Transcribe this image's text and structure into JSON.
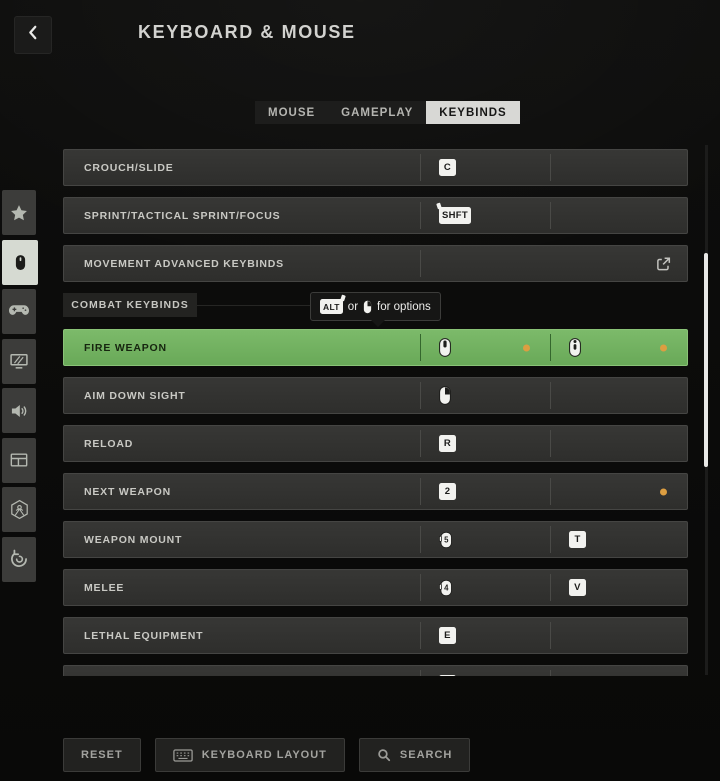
{
  "header": {
    "title": "KEYBOARD & MOUSE"
  },
  "tabs": {
    "items": [
      {
        "label": "MOUSE",
        "selected": false
      },
      {
        "label": "GAMEPLAY",
        "selected": false
      },
      {
        "label": "KEYBINDS",
        "selected": true
      }
    ]
  },
  "sidebar": {
    "items": [
      {
        "icon": "star-icon",
        "selected": false
      },
      {
        "icon": "mouse-icon",
        "selected": true
      },
      {
        "icon": "gamepad-icon",
        "selected": false
      },
      {
        "icon": "display-icon",
        "selected": false
      },
      {
        "icon": "speaker-icon",
        "selected": false
      },
      {
        "icon": "interface-icon",
        "selected": false
      },
      {
        "icon": "broadcast-icon",
        "selected": false
      },
      {
        "icon": "refresh-icon",
        "selected": false
      }
    ]
  },
  "tooltip": {
    "key_label": "ALT",
    "middle_text": "or",
    "mouse_icon": "mouse-right-icon",
    "end_text": "for options"
  },
  "keybinds": {
    "section_label": "COMBAT KEYBINDS",
    "movement_rows": [
      {
        "label": "CROUCH/SLIDE",
        "slot1": {
          "type": "key",
          "label": "C"
        },
        "slot2": {
          "type": "none"
        }
      },
      {
        "label": "SPRINT/TACTICAL SPRINT/FOCUS",
        "slot1": {
          "type": "key",
          "label": "SHFT",
          "modifier": true
        },
        "slot2": {
          "type": "none"
        }
      },
      {
        "label": "MOVEMENT ADVANCED KEYBINDS",
        "advanced": true
      }
    ],
    "combat_rows": [
      {
        "label": "FIRE WEAPON",
        "highlighted": true,
        "slot1": {
          "type": "mouse",
          "variant": "left",
          "dot": true
        },
        "slot2": {
          "type": "mouse",
          "variant": "middle",
          "dot": true
        }
      },
      {
        "label": "AIM DOWN SIGHT",
        "slot1": {
          "type": "mouse",
          "variant": "right"
        },
        "slot2": {
          "type": "none"
        }
      },
      {
        "label": "RELOAD",
        "slot1": {
          "type": "key",
          "label": "R"
        },
        "slot2": {
          "type": "none"
        }
      },
      {
        "label": "NEXT WEAPON",
        "slot1": {
          "type": "key",
          "label": "2"
        },
        "slot2": {
          "type": "none",
          "dot": true
        }
      },
      {
        "label": "WEAPON MOUNT",
        "slot1": {
          "type": "mouse",
          "variant": "num",
          "num": "5"
        },
        "slot2": {
          "type": "key",
          "label": "T"
        }
      },
      {
        "label": "MELEE",
        "slot1": {
          "type": "mouse",
          "variant": "num",
          "num": "4"
        },
        "slot2": {
          "type": "key",
          "label": "V"
        }
      },
      {
        "label": "LETHAL EQUIPMENT",
        "slot1": {
          "type": "key",
          "label": "E"
        },
        "slot2": {
          "type": "none"
        }
      },
      {
        "label": "",
        "clipped": true,
        "slot1": {
          "type": "key",
          "label": ""
        },
        "slot2": {
          "type": "none"
        }
      }
    ]
  },
  "footer": {
    "buttons": [
      {
        "label": "RESET"
      },
      {
        "label": "KEYBOARD LAYOUT",
        "icon": "keyboard-icon"
      },
      {
        "label": "SEARCH",
        "icon": "search-icon"
      }
    ]
  },
  "colors": {
    "highlight_green": "#74b363",
    "dot_orange": "#dd9e41",
    "key_bg": "#f2f2ef"
  }
}
